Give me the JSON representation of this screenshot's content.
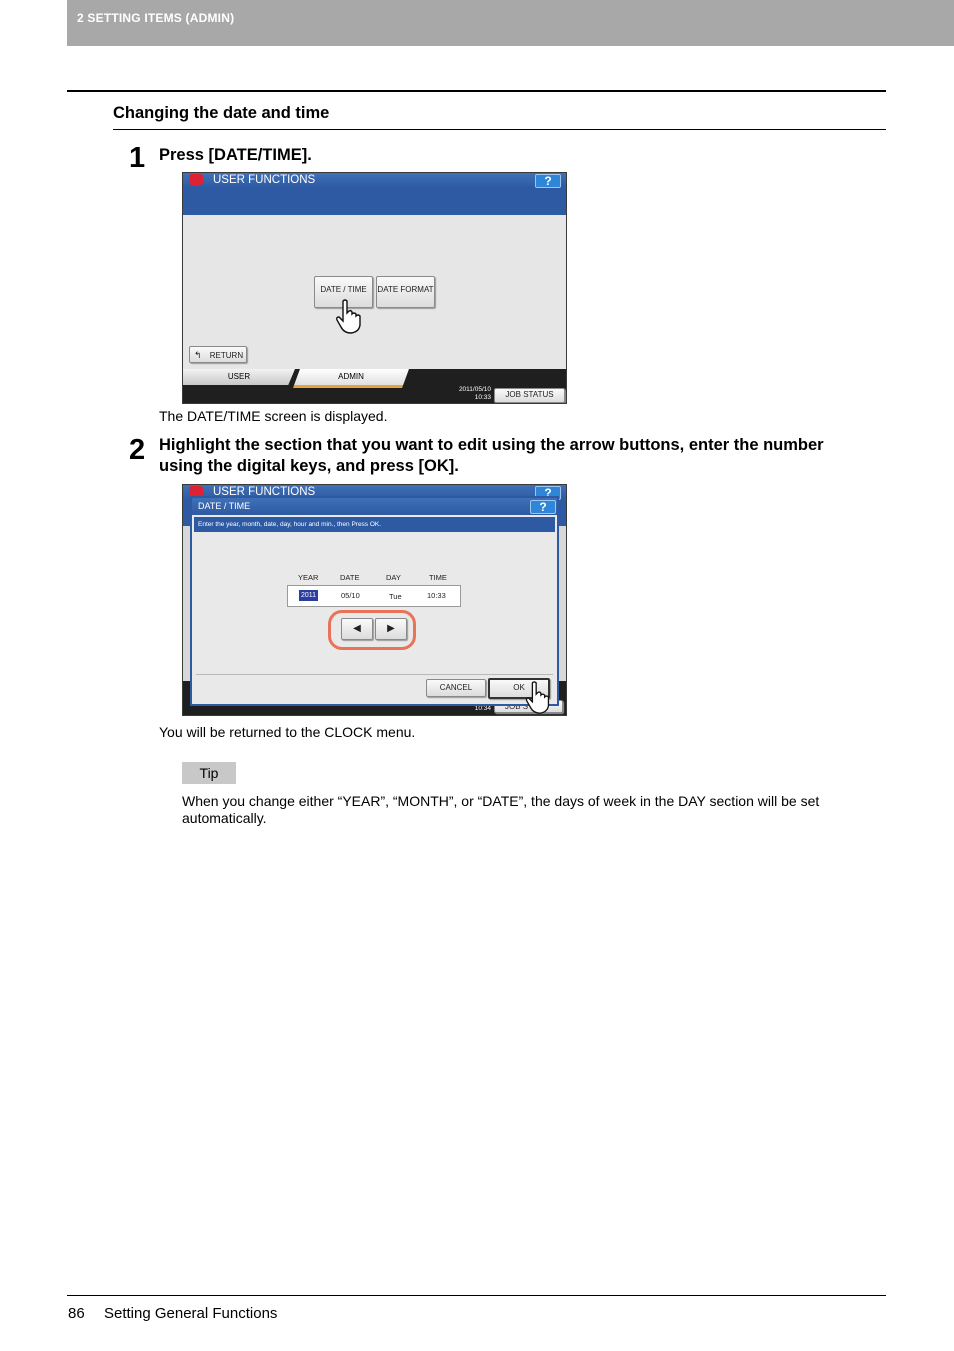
{
  "header": {
    "section": "2 SETTING ITEMS (ADMIN)"
  },
  "section_title": "Changing the date and time",
  "steps": [
    {
      "number": "1",
      "instruction": "Press [DATE/TIME].",
      "result": "The DATE/TIME screen is displayed."
    },
    {
      "number": "2",
      "instruction_line1": "Highlight the section that you want to edit using the arrow buttons, enter the number",
      "instruction_line2": "using the digital keys, and press [OK].",
      "result": "You will be returned to the CLOCK menu."
    }
  ],
  "screen1": {
    "title": "USER FUNCTIONS",
    "help": "?",
    "btn_datetime": "DATE / TIME",
    "btn_dateformat": "DATE FORMAT",
    "btn_return": "RETURN",
    "tab_user": "USER",
    "tab_admin": "ADMIN",
    "date": "2011/05/10",
    "time": "10:33",
    "job_status": "JOB STATUS"
  },
  "screen2": {
    "title": "USER FUNCTIONS",
    "help": "?",
    "dialog_title": "DATE / TIME",
    "instruction": "Enter the year, month, date, day, hour and min., then Press OK.",
    "col_year": "YEAR",
    "col_date": "DATE",
    "col_day": "DAY",
    "col_time": "TIME",
    "val_year": "2011",
    "val_date": "05/10",
    "val_day": "Tue",
    "val_time": "10:33",
    "btn_cancel": "CANCEL",
    "btn_ok": "OK",
    "bg_time": "10:34",
    "bg_job": "JOB S"
  },
  "tip": {
    "label": "Tip",
    "line1": "When you change either “YEAR”, “MONTH”, or “DATE”, the days of week in the DAY section will be set",
    "line2": "automatically."
  },
  "footer": {
    "page": "86",
    "title": "Setting General Functions"
  },
  "colors": {
    "title_blue": "#2d5aa3",
    "highlight_ring": "#e8735a",
    "admin_tab": "#e8a33c"
  }
}
